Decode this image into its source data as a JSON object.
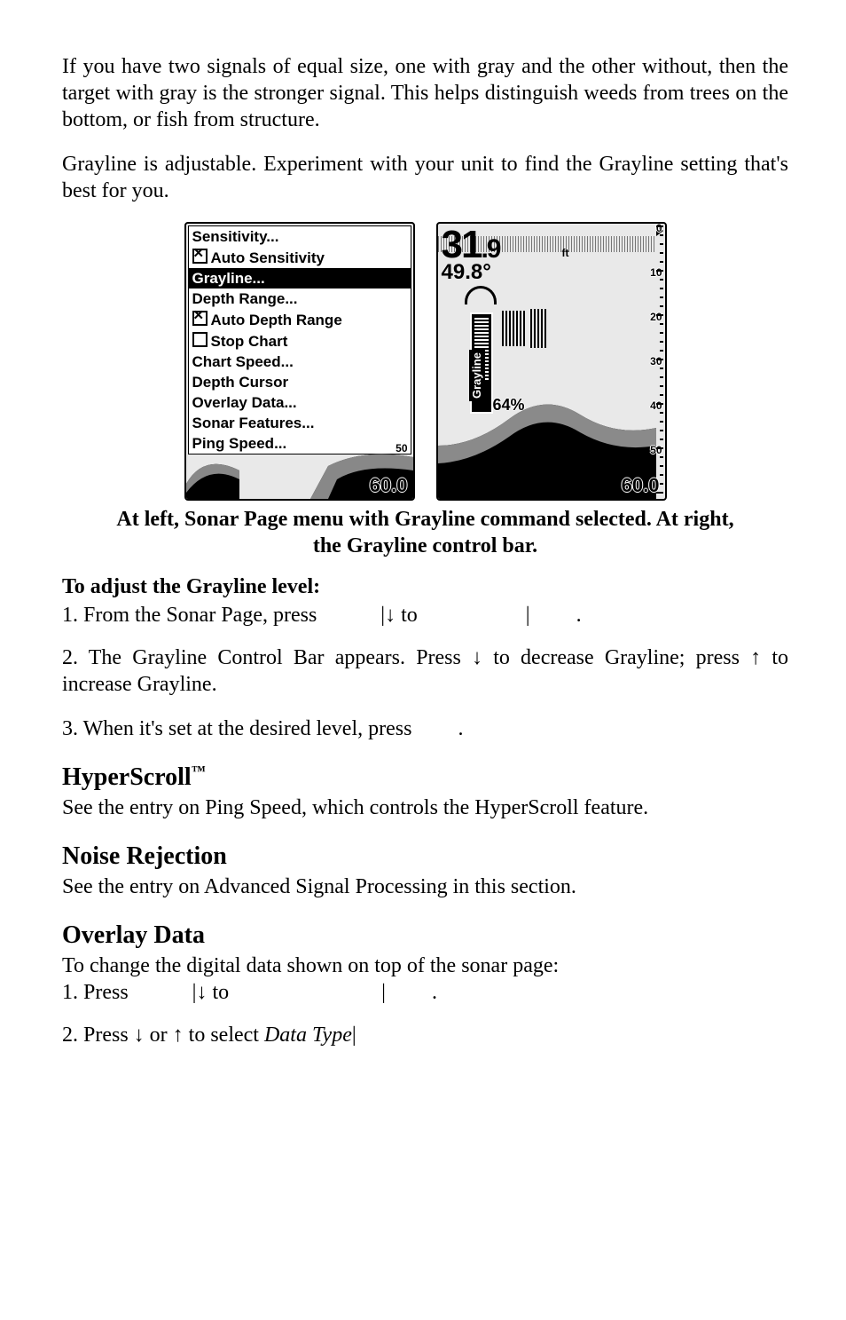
{
  "body": {
    "p1": "If you have two signals of equal size, one with gray and the other without, then the target with gray is the stronger signal. This helps distinguish weeds from trees on the bottom, or fish from structure.",
    "p2": "Grayline is adjustable. Experiment with your unit to find the Grayline setting that's best for you.",
    "caption": "At left, Sonar Page menu with Grayline command selected. At right, the Grayline control bar.",
    "h_adjust": "To adjust the Grayline level:",
    "step1a": "1. From the Sonar Page, press ",
    "step1b": "|↓ to ",
    "step1c": "|",
    "step1d": ".",
    "step2": "2. The Grayline Control Bar appears. Press ↓ to decrease Grayline; press ↑ to increase Grayline.",
    "step3": "3. When it's set at the desired level, press ",
    "step3b": ".",
    "h_hyper": "HyperScroll",
    "tm": "™",
    "p_hyper": "See the entry on Ping Speed, which controls the HyperScroll feature.",
    "h_noise": "Noise Rejection",
    "p_noise": "See the entry on Advanced Signal Processing in this section.",
    "h_overlay": "Overlay Data",
    "p_overlay_intro": "To change the digital data shown on top of the sonar page:",
    "ostep1a": "1. Press ",
    "ostep1b": "|↓ to ",
    "ostep1c": "|",
    "ostep1d": ".",
    "ostep2a": "2. Press ↓ or ↑ to select ",
    "ostep2_italic": "Data Type",
    "ostep2b": "|"
  },
  "left_menu": {
    "items": [
      {
        "label": "Sensitivity...",
        "checkbox": null,
        "selected": false
      },
      {
        "label": "Auto Sensitivity",
        "checkbox": true,
        "selected": false
      },
      {
        "label": "Grayline...",
        "checkbox": null,
        "selected": true
      },
      {
        "label": "Depth Range...",
        "checkbox": null,
        "selected": false
      },
      {
        "label": "Auto Depth Range",
        "checkbox": true,
        "selected": false
      },
      {
        "label": "Stop Chart",
        "checkbox": false,
        "selected": false
      },
      {
        "label": "Chart Speed...",
        "checkbox": null,
        "selected": false
      },
      {
        "label": "Depth Cursor",
        "checkbox": null,
        "selected": false
      },
      {
        "label": "Overlay Data...",
        "checkbox": null,
        "selected": false
      },
      {
        "label": "Sonar Features...",
        "checkbox": null,
        "selected": false
      },
      {
        "label": "Ping Speed...",
        "checkbox": null,
        "selected": false
      }
    ],
    "range_btm": "60.0",
    "small_top": "50"
  },
  "right_screen": {
    "depth_main": "31",
    "depth_dec": ".9",
    "depth_unit": "ft",
    "temp": "49.8°",
    "grayline_label": "Grayline",
    "grayline_pct": "64%",
    "scale": {
      "zero": "0",
      "v10": "10",
      "v20": "20",
      "v30": "30",
      "v40": "40",
      "v50": "50",
      "btm": "60.0"
    }
  }
}
